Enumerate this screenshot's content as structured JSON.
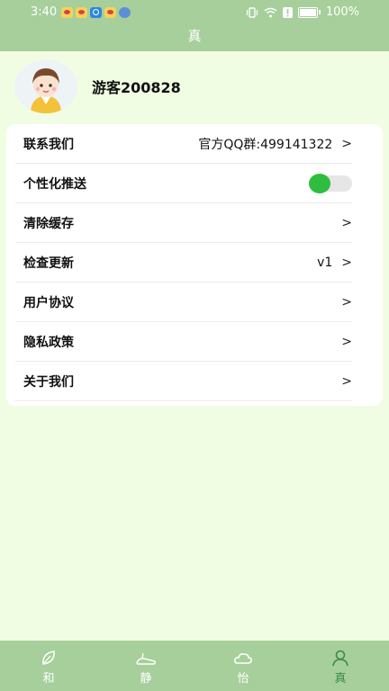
{
  "status_bar": {
    "time": "3:40",
    "app_icons": [
      "eye-app-icon",
      "eye-app-icon",
      "search-app-icon",
      "eye-app-icon",
      "globe-app-icon"
    ],
    "battery": "100%"
  },
  "header": {
    "title": "真"
  },
  "profile": {
    "username": "游客200828"
  },
  "settings": {
    "contact": {
      "label": "联系我们",
      "value": "官方QQ群:499141322",
      "chevron": ">"
    },
    "push": {
      "label": "个性化推送",
      "enabled": true,
      "accent": "#2fbd3f"
    },
    "clear_cache": {
      "label": "清除缓存",
      "chevron": ">"
    },
    "update": {
      "label": "检查更新",
      "value": "v1",
      "chevron": ">"
    },
    "agreement": {
      "label": "用户协议",
      "chevron": ">"
    },
    "privacy": {
      "label": "隐私政策",
      "chevron": ">"
    },
    "about": {
      "label": "关于我们",
      "chevron": ">"
    }
  },
  "bottom_nav": {
    "tabs": [
      {
        "label": "和",
        "icon": "leaf-icon",
        "active": false
      },
      {
        "label": "静",
        "icon": "slipper-icon",
        "active": false
      },
      {
        "label": "怡",
        "icon": "cloud-icon",
        "active": false
      },
      {
        "label": "真",
        "icon": "user-icon",
        "active": true
      }
    ]
  },
  "colors": {
    "bar_green": "#a6cf9b",
    "page_bg": "#f1fde2",
    "active_tab": "#3a8a4f"
  }
}
